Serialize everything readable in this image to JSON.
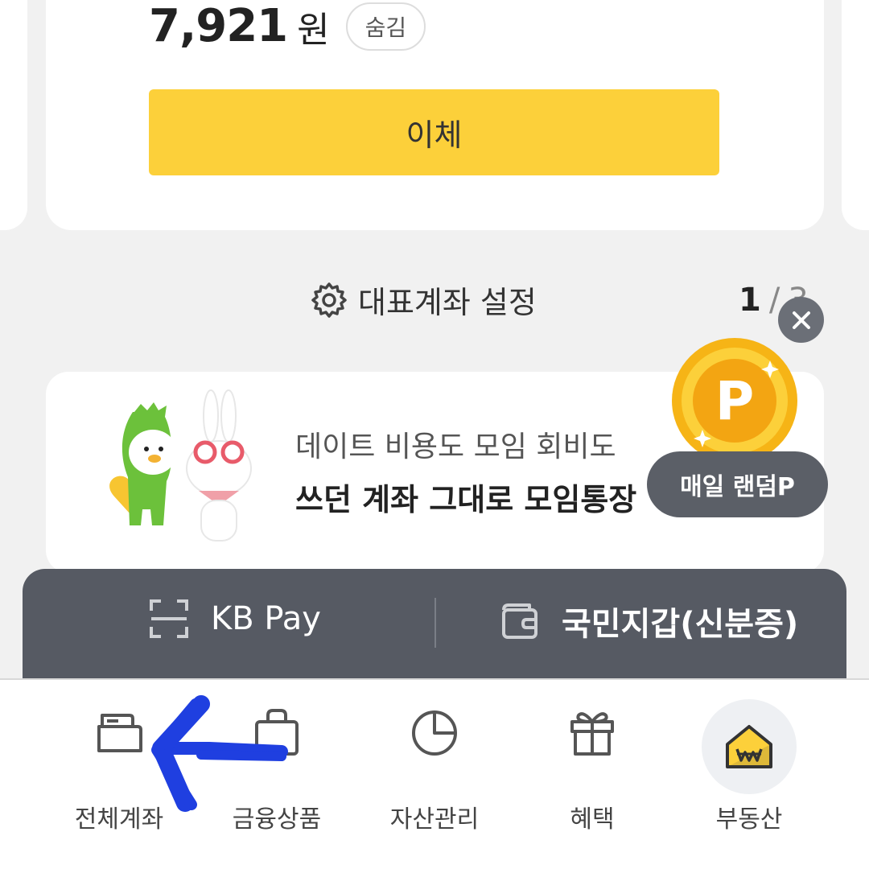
{
  "account": {
    "balance": "7,921",
    "unit": "원",
    "hide_label": "숨김",
    "transfer_label": "이체"
  },
  "settings": {
    "rep_account_label": "대표계좌 설정"
  },
  "pager": {
    "current": "1",
    "separator": "/",
    "total": "3"
  },
  "banner": {
    "line1": "데이트 비용도 모임 회비도",
    "line2": "쓰던 계좌 그대로 모임통장"
  },
  "floating": {
    "coin_letter": "P",
    "random_point_label": "매일 랜덤P"
  },
  "pay_bar": {
    "kb_pay": "KB Pay",
    "wallet": "국민지갑(신분증)"
  },
  "tabs": [
    {
      "label": "전체계좌",
      "icon": "card-icon"
    },
    {
      "label": "금융상품",
      "icon": "bag-icon"
    },
    {
      "label": "자산관리",
      "icon": "pie-chart-icon"
    },
    {
      "label": "혜택",
      "icon": "gift-icon"
    },
    {
      "label": "부동산",
      "icon": "house-won-icon"
    }
  ],
  "colors": {
    "transfer_button": "#fcd03a",
    "pay_bar": "#565a63",
    "annotation_arrow": "#1f3fe0"
  }
}
